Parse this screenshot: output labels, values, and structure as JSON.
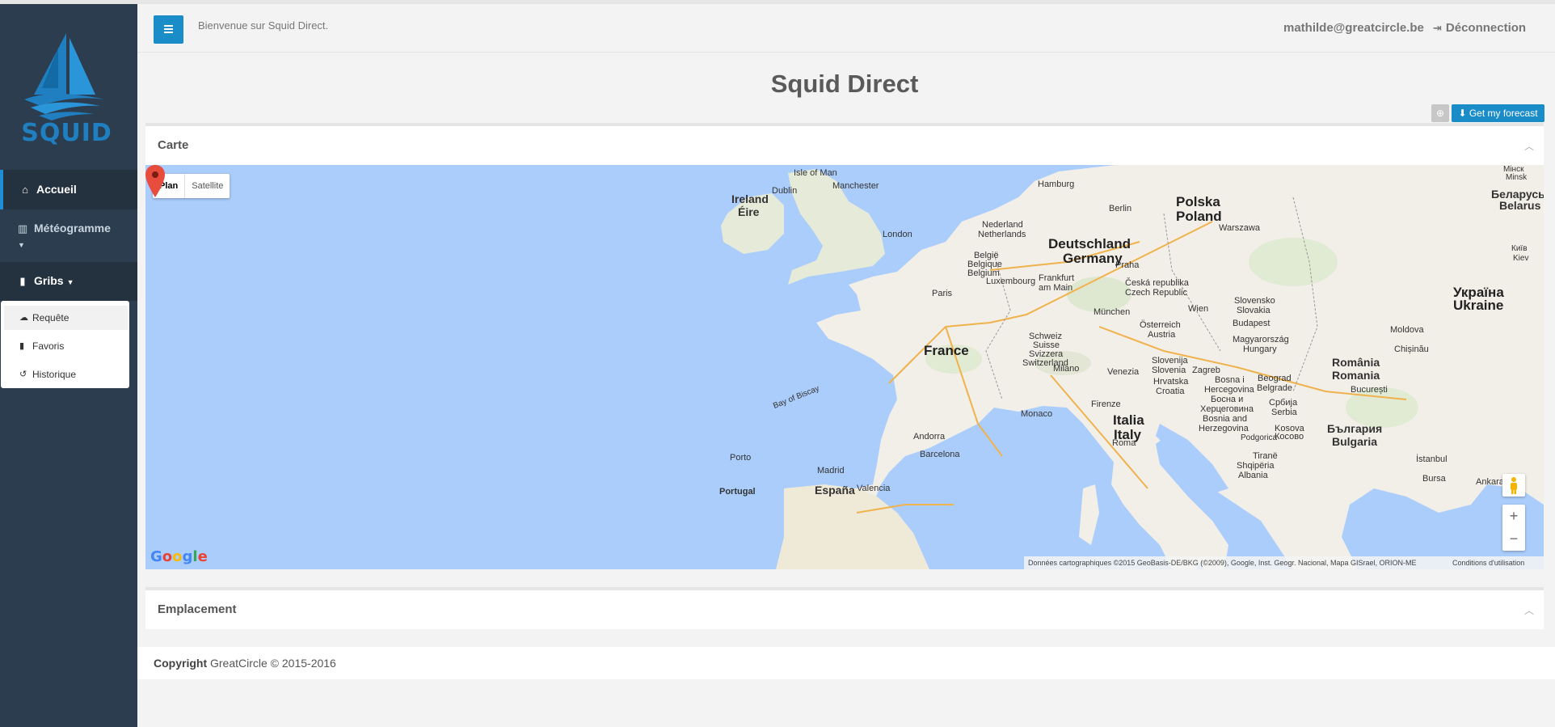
{
  "sidebar": {
    "logo_text": "SQUID",
    "items": [
      {
        "label": "Accueil",
        "icon": "home-icon"
      },
      {
        "label": "Météogramme",
        "icon": "bar-chart-icon"
      },
      {
        "label": "Gribs",
        "icon": "file-icon"
      }
    ],
    "submenu": [
      {
        "label": "Requête",
        "icon": "cloud-download-icon"
      },
      {
        "label": "Favoris",
        "icon": "bookmark-icon"
      },
      {
        "label": "Historique",
        "icon": "history-icon"
      }
    ]
  },
  "header": {
    "welcome": "Bienvenue sur Squid Direct.",
    "user_email": "mathilde@greatcircle.be",
    "logout_label": "Déconnection"
  },
  "page": {
    "title": "Squid Direct",
    "forecast_button": "Get my forecast"
  },
  "carte": {
    "title": "Carte",
    "map_types": [
      "Plan",
      "Satellite"
    ],
    "google_logo": "Google",
    "attribution": "Données cartographiques ©2015 GeoBasis-DE/BKG (©2009), Google, Inst. Geogr. Nacional, Mapa GISrael, ORION-ME",
    "terms": "Conditions d'utilisation",
    "zoom_in": "+",
    "zoom_out": "−",
    "labels": {
      "isle_of_man": "Isle of Man",
      "dublin": "Dublin",
      "ireland": "Ireland",
      "eire": "Éire",
      "manchester": "Manchester",
      "london": "London",
      "hamburg": "Hamburg",
      "berlin": "Berlin",
      "polska": "Polska",
      "poland": "Poland",
      "minsk": "Мінск",
      "minsk2": "Minsk",
      "belarus_cy": "Беларусь",
      "belarus": "Belarus",
      "nederland": "Nederland",
      "netherlands": "Netherlands",
      "deutschland": "Deutschland",
      "germany": "Germany",
      "warszawa": "Warszawa",
      "belgie": "België",
      "belgique": "Belgique",
      "belgium": "Belgium",
      "luxembourg": "Luxembourg",
      "frankfurt": "Frankfurt",
      "am_main": "am Main",
      "praha": "Praha",
      "ceska": "Česká republika",
      "czech": "Czech Republic",
      "kyiv": "Київ",
      "kiev": "Kiev",
      "paris": "Paris",
      "ukraina": "Україна",
      "ukraine": "Ukraine",
      "slovensko": "Slovensko",
      "slovakia": "Slovakia",
      "munchen": "München",
      "wien": "Wien",
      "budapest": "Budapest",
      "osterreich": "Österreich",
      "austria": "Austria",
      "france": "France",
      "schweiz": "Schweiz",
      "suisse": "Suisse",
      "svizzera": "Svizzera",
      "switzerland": "Switzerland",
      "magyar": "Magyarország",
      "hungary": "Hungary",
      "moldova": "Moldova",
      "chisinau": "Chișinău",
      "milano": "Milano",
      "venezia": "Venezia",
      "slovenija": "Slovenija",
      "slovenia": "Slovenia",
      "zagreb": "Zagreb",
      "romania_ro": "România",
      "romania": "Romania",
      "bay_of_biscay": "Bay of Biscay",
      "hrvatska": "Hrvatska",
      "croatia": "Croatia",
      "bosna": "Bosna i",
      "hercegovina": "Hercegovina",
      "bosna_cy": "Босна и",
      "herceg_cy": "Херцеговина",
      "bosnia": "Bosnia and",
      "herzegovina": "Herzegovina",
      "beograd": "Beograd",
      "belgrade": "Belgrade",
      "srbija_cy": "Србија",
      "serbia": "Serbia",
      "bucuresti": "București",
      "monaco": "Monaco",
      "firenze": "Firenze",
      "italia": "Italia",
      "italy": "Italy",
      "andorra": "Andorra",
      "barcelona": "Barcelona",
      "roma": "Roma",
      "podgorica": "Podgorica",
      "kosova": "Kosova",
      "kosovo_cy": "Косово",
      "bulgaria_cy": "България",
      "bulgaria": "Bulgaria",
      "porto": "Porto",
      "madrid": "Madrid",
      "tirane": "Tiranë",
      "shqiperia": "Shqipëria",
      "albania": "Albania",
      "istanbul": "İstanbul",
      "bursa": "Bursa",
      "ankara": "Ankara",
      "portugal": "Portugal",
      "espana": "España",
      "valencia": "Valencia"
    }
  },
  "emplacement": {
    "title": "Emplacement"
  },
  "footer": {
    "copyright_label": "Copyright",
    "copyright_text": "GreatCircle © 2015-2016"
  },
  "colors": {
    "sidebar": "#2b3d4f",
    "accent": "#1a8cc7",
    "water": "#abcdfb",
    "land": "#f2efe9"
  }
}
